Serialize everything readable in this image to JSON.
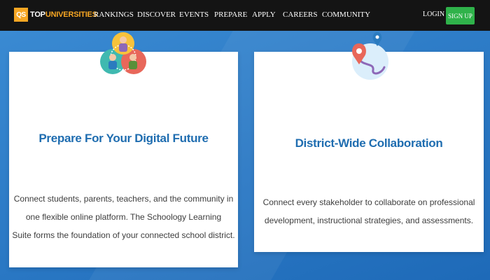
{
  "nav": {
    "logo_mark": "QS",
    "logo_text_1": "TOP",
    "logo_text_2": "UNIVERSITIES",
    "items": [
      "RANKINGS",
      "DISCOVER",
      "EVENTS",
      "PREPARE",
      "APPLY",
      "CAREERS",
      "COMMUNITY"
    ],
    "login": "LOGIN",
    "signup": "SIGN UP"
  },
  "cards": [
    {
      "title": "Prepare For Your Digital Future",
      "lines": [
        "Connect students, parents, teachers, and the community in",
        "one flexible online platform. The Schoology Learning",
        "Suite forms the foundation of your connected school district."
      ]
    },
    {
      "title": "District-Wide Collaboration",
      "lines": [
        "Connect every stakeholder to collaborate on professional",
        "development, instructional strategies, and assessments."
      ]
    }
  ],
  "icons": [
    "qs-logo-icon",
    "people-community-icon",
    "map-route-pin-icon"
  ],
  "colors": {
    "nav_bg": "#141414",
    "brand_orange": "#f6a623",
    "signup_green": "#2fb24a",
    "page_blue": "#2d7dc8",
    "title_blue": "#1f6db0"
  }
}
